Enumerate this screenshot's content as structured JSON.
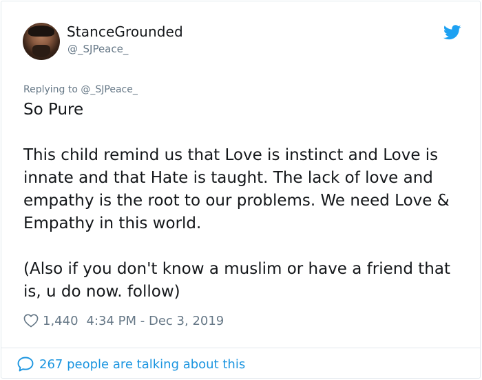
{
  "author": {
    "display_name": "StanceGrounded",
    "handle": "@_SJPeace_"
  },
  "tweet": {
    "replying_to": "Replying to @_SJPeace_",
    "paragraphs": [
      "So Pure",
      "This child remind us that Love is instinct and Love is innate and that Hate is taught. The lack of love and empathy is the root to our problems. We need Love & Empathy in this world.",
      "(Also if you don't know a muslim or have a friend that is, u do now. follow)"
    ],
    "likes": "1,440",
    "timestamp": "4:34 PM - Dec 3, 2019"
  },
  "footer": {
    "conversation": "267 people are talking about this"
  },
  "icons": {
    "brand": "twitter-bird-icon",
    "like": "heart-outline-icon",
    "comment": "speech-bubble-icon"
  },
  "colors": {
    "brand_blue": "#1da1f2",
    "link_blue": "#1b95e0",
    "text": "#14171a",
    "muted": "#657786",
    "border": "#e1e8ed"
  }
}
